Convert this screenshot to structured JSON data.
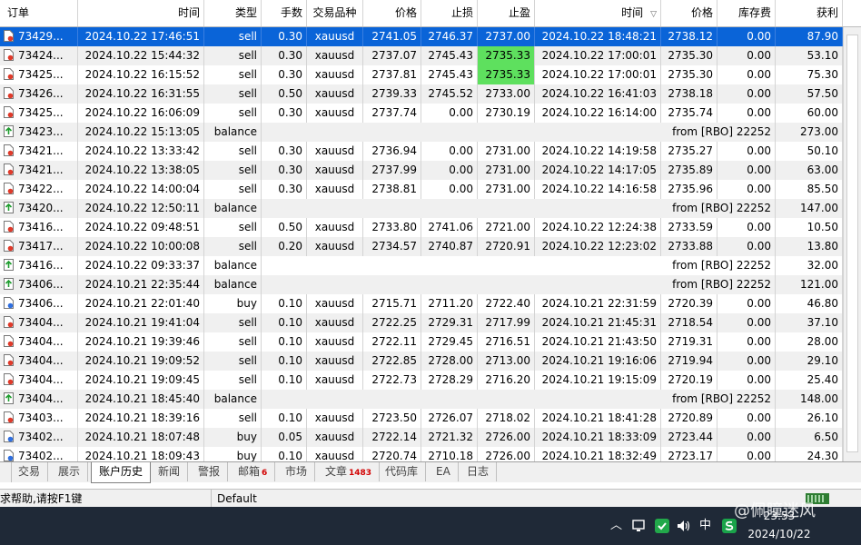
{
  "headers": [
    "订单",
    "时间",
    "类型",
    "手数",
    "交易品种",
    "价格",
    "止损",
    "止盈",
    "时间",
    "价格",
    "库存费",
    "获利"
  ],
  "rows": [
    {
      "order": "73429...",
      "time1": "2024.10.22 17:46:51",
      "type": "sell",
      "lot": "0.30",
      "sym": "xauusd",
      "price": "2741.05",
      "sl": "2746.37",
      "tp": "2737.00",
      "time2": "2024.10.22 18:48:21",
      "price2": "2738.12",
      "swap": "0.00",
      "profit": "87.90",
      "selected": true
    },
    {
      "order": "73424...",
      "time1": "2024.10.22 15:44:32",
      "type": "sell",
      "lot": "0.30",
      "sym": "xauusd",
      "price": "2737.07",
      "sl": "2745.43",
      "tp": "2735.33",
      "time2": "2024.10.22 17:00:01",
      "price2": "2735.30",
      "swap": "0.00",
      "profit": "53.10",
      "tp_hit": true
    },
    {
      "order": "73425...",
      "time1": "2024.10.22 16:15:52",
      "type": "sell",
      "lot": "0.30",
      "sym": "xauusd",
      "price": "2737.81",
      "sl": "2745.43",
      "tp": "2735.33",
      "time2": "2024.10.22 17:00:01",
      "price2": "2735.30",
      "swap": "0.00",
      "profit": "75.30",
      "tp_hit": true
    },
    {
      "order": "73426...",
      "time1": "2024.10.22 16:31:55",
      "type": "sell",
      "lot": "0.50",
      "sym": "xauusd",
      "price": "2739.33",
      "sl": "2745.52",
      "tp": "2733.00",
      "time2": "2024.10.22 16:41:03",
      "price2": "2738.18",
      "swap": "0.00",
      "profit": "57.50"
    },
    {
      "order": "73425...",
      "time1": "2024.10.22 16:06:09",
      "type": "sell",
      "lot": "0.30",
      "sym": "xauusd",
      "price": "2737.74",
      "sl": "0.00",
      "tp": "2730.19",
      "time2": "2024.10.22 16:14:00",
      "price2": "2735.74",
      "swap": "0.00",
      "profit": "60.00"
    },
    {
      "order": "73423...",
      "time1": "2024.10.22 15:13:05",
      "type": "balance",
      "comment": "from [RBO] 22252",
      "profit": "273.00"
    },
    {
      "order": "73421...",
      "time1": "2024.10.22 13:33:42",
      "type": "sell",
      "lot": "0.30",
      "sym": "xauusd",
      "price": "2736.94",
      "sl": "0.00",
      "tp": "2731.00",
      "time2": "2024.10.22 14:19:58",
      "price2": "2735.27",
      "swap": "0.00",
      "profit": "50.10"
    },
    {
      "order": "73421...",
      "time1": "2024.10.22 13:38:05",
      "type": "sell",
      "lot": "0.30",
      "sym": "xauusd",
      "price": "2737.99",
      "sl": "0.00",
      "tp": "2731.00",
      "time2": "2024.10.22 14:17:05",
      "price2": "2735.89",
      "swap": "0.00",
      "profit": "63.00"
    },
    {
      "order": "73422...",
      "time1": "2024.10.22 14:00:04",
      "type": "sell",
      "lot": "0.30",
      "sym": "xauusd",
      "price": "2738.81",
      "sl": "0.00",
      "tp": "2731.00",
      "time2": "2024.10.22 14:16:58",
      "price2": "2735.96",
      "swap": "0.00",
      "profit": "85.50"
    },
    {
      "order": "73420...",
      "time1": "2024.10.22 12:50:11",
      "type": "balance",
      "comment": "from [RBO] 22252",
      "profit": "147.00"
    },
    {
      "order": "73416...",
      "time1": "2024.10.22 09:48:51",
      "type": "sell",
      "lot": "0.50",
      "sym": "xauusd",
      "price": "2733.80",
      "sl": "2741.06",
      "tp": "2721.00",
      "time2": "2024.10.22 12:24:38",
      "price2": "2733.59",
      "swap": "0.00",
      "profit": "10.50"
    },
    {
      "order": "73417...",
      "time1": "2024.10.22 10:00:08",
      "type": "sell",
      "lot": "0.20",
      "sym": "xauusd",
      "price": "2734.57",
      "sl": "2740.87",
      "tp": "2720.91",
      "time2": "2024.10.22 12:23:02",
      "price2": "2733.88",
      "swap": "0.00",
      "profit": "13.80"
    },
    {
      "order": "73416...",
      "time1": "2024.10.22 09:33:37",
      "type": "balance",
      "comment": "from [RBO] 22252",
      "profit": "32.00"
    },
    {
      "order": "73406...",
      "time1": "2024.10.21 22:35:44",
      "type": "balance",
      "comment": "from [RBO] 22252",
      "profit": "121.00"
    },
    {
      "order": "73406...",
      "time1": "2024.10.21 22:01:40",
      "type": "buy",
      "lot": "0.10",
      "sym": "xauusd",
      "price": "2715.71",
      "sl": "2711.20",
      "tp": "2722.40",
      "time2": "2024.10.21 22:31:59",
      "price2": "2720.39",
      "swap": "0.00",
      "profit": "46.80"
    },
    {
      "order": "73404...",
      "time1": "2024.10.21 19:41:04",
      "type": "sell",
      "lot": "0.10",
      "sym": "xauusd",
      "price": "2722.25",
      "sl": "2729.31",
      "tp": "2717.99",
      "time2": "2024.10.21 21:45:31",
      "price2": "2718.54",
      "swap": "0.00",
      "profit": "37.10"
    },
    {
      "order": "73404...",
      "time1": "2024.10.21 19:39:46",
      "type": "sell",
      "lot": "0.10",
      "sym": "xauusd",
      "price": "2722.11",
      "sl": "2729.45",
      "tp": "2716.51",
      "time2": "2024.10.21 21:43:50",
      "price2": "2719.31",
      "swap": "0.00",
      "profit": "28.00"
    },
    {
      "order": "73404...",
      "time1": "2024.10.21 19:09:52",
      "type": "sell",
      "lot": "0.10",
      "sym": "xauusd",
      "price": "2722.85",
      "sl": "2728.00",
      "tp": "2713.00",
      "time2": "2024.10.21 19:16:06",
      "price2": "2719.94",
      "swap": "0.00",
      "profit": "29.10"
    },
    {
      "order": "73404...",
      "time1": "2024.10.21 19:09:45",
      "type": "sell",
      "lot": "0.10",
      "sym": "xauusd",
      "price": "2722.73",
      "sl": "2728.29",
      "tp": "2716.20",
      "time2": "2024.10.21 19:15:09",
      "price2": "2720.19",
      "swap": "0.00",
      "profit": "25.40"
    },
    {
      "order": "73404...",
      "time1": "2024.10.21 18:45:40",
      "type": "balance",
      "comment": "from [RBO] 22252",
      "profit": "148.00"
    },
    {
      "order": "73403...",
      "time1": "2024.10.21 18:39:16",
      "type": "sell",
      "lot": "0.10",
      "sym": "xauusd",
      "price": "2723.50",
      "sl": "2726.07",
      "tp": "2718.02",
      "time2": "2024.10.21 18:41:28",
      "price2": "2720.89",
      "swap": "0.00",
      "profit": "26.10"
    },
    {
      "order": "73402...",
      "time1": "2024.10.21 18:07:48",
      "type": "buy",
      "lot": "0.05",
      "sym": "xauusd",
      "price": "2722.14",
      "sl": "2721.32",
      "tp": "2726.00",
      "time2": "2024.10.21 18:33:09",
      "price2": "2723.44",
      "swap": "0.00",
      "profit": "6.50"
    },
    {
      "order": "73402...",
      "time1": "2024.10.21 18:09:43",
      "type": "buy",
      "lot": "0.10",
      "sym": "xauusd",
      "price": "2720.74",
      "sl": "2710.18",
      "tp": "2726.00",
      "time2": "2024.10.21 18:32:49",
      "price2": "2723.17",
      "swap": "0.00",
      "profit": "24.30"
    }
  ],
  "tabs": [
    {
      "label": "交易"
    },
    {
      "label": "展示"
    },
    {
      "label": "账户历史",
      "active": true
    },
    {
      "label": "新闻"
    },
    {
      "label": "警报"
    },
    {
      "label": "邮箱",
      "badge": "6"
    },
    {
      "label": "市场"
    },
    {
      "label": "文章",
      "badge": "1483"
    },
    {
      "label": "代码库"
    },
    {
      "label": "EA"
    },
    {
      "label": "日志"
    }
  ],
  "status": {
    "help": "求帮助,请按F1键",
    "profile": "Default"
  },
  "taskbar": {
    "ime": "中",
    "time": "23:53",
    "date": "2024/10/22",
    "watermark": "@佩瞳迷风"
  },
  "colors": {
    "selected": "#0a64d8",
    "tp_hit": "#5ee05e",
    "odd_row": "#f0f0f0",
    "badge": "#d20000"
  }
}
